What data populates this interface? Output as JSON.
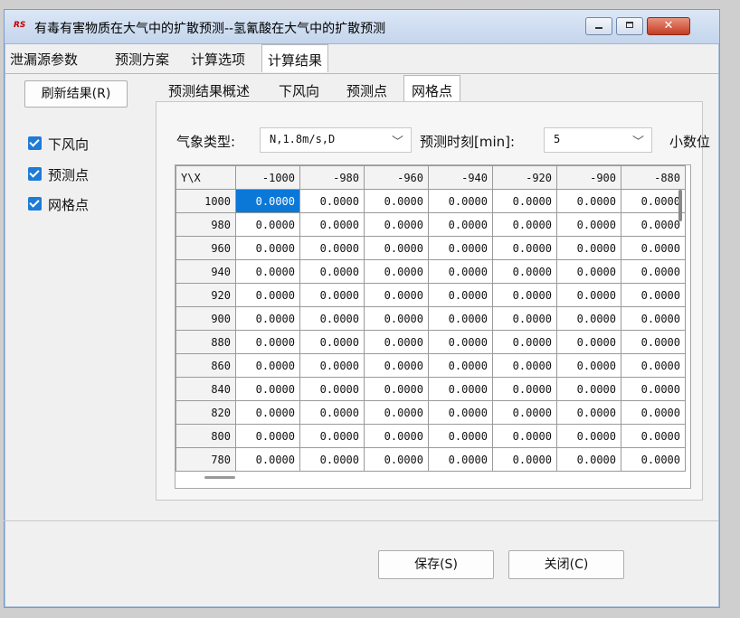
{
  "window": {
    "app_icon_text": "RS",
    "title": "有毒有害物质在大气中的扩散预测--氢氰酸在大气中的扩散预测",
    "buttons": {
      "minimize": "—",
      "maximize": "□",
      "close": "✕"
    }
  },
  "main_tabs": [
    "泄漏源参数",
    "预测方案",
    "计算选项",
    "计算结果"
  ],
  "main_tabs_active": "计算结果",
  "left_panel": {
    "refresh_button": "刷新结果(R)",
    "checkboxes": [
      {
        "label": "下风向",
        "checked": true
      },
      {
        "label": "预测点",
        "checked": true
      },
      {
        "label": "网格点",
        "checked": true
      }
    ]
  },
  "inner_tabs": [
    "预测结果概述",
    "下风向",
    "预测点",
    "网格点"
  ],
  "inner_tabs_active": "网格点",
  "controls": {
    "weather_label": "气象类型:",
    "weather_value": "N,1.8m/s,D",
    "time_label": "预测时刻[min]:",
    "time_value": "5",
    "decimals_label": "小数位"
  },
  "grid": {
    "corner": "Y\\X",
    "x_headers": [
      "-1000",
      "-980",
      "-960",
      "-940",
      "-920",
      "-900",
      "-880"
    ],
    "y_headers": [
      "1000",
      "980",
      "960",
      "940",
      "920",
      "900",
      "880",
      "860",
      "840",
      "820",
      "800",
      "780"
    ],
    "cell_value": "0.0000",
    "selected_cell": {
      "row": 0,
      "col": 0
    }
  },
  "footer": {
    "save_button": "保存(S)",
    "close_button": "关闭(C)"
  }
}
